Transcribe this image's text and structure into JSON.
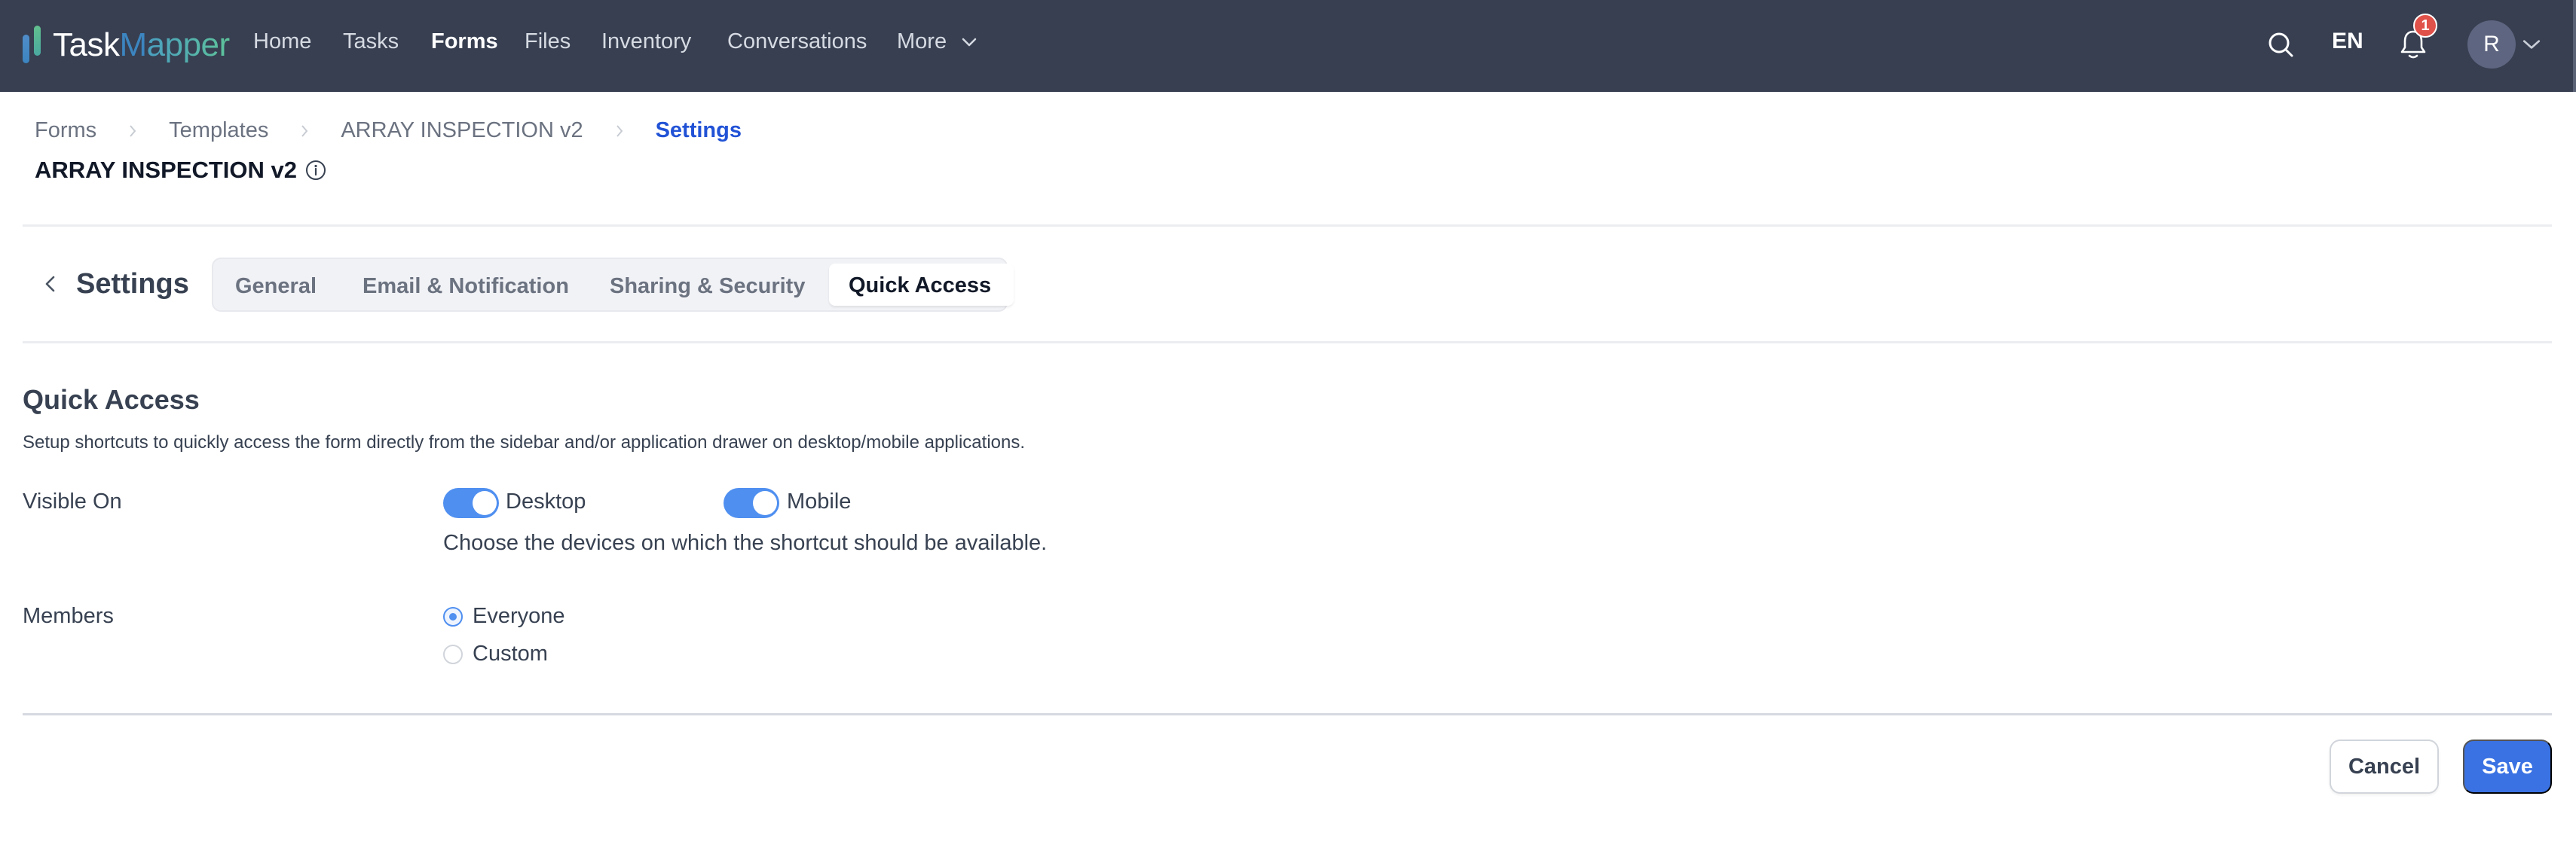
{
  "app": {
    "logo": {
      "part1": "Task",
      "part2": "M",
      "part3": "apper"
    }
  },
  "nav": {
    "items": [
      {
        "label": "Home",
        "active": false
      },
      {
        "label": "Tasks",
        "active": false
      },
      {
        "label": "Forms",
        "active": true
      },
      {
        "label": "Files",
        "active": false
      },
      {
        "label": "Inventory",
        "active": false
      },
      {
        "label": "Conversations",
        "active": false
      },
      {
        "label": "More",
        "active": false
      }
    ],
    "language": "EN",
    "notification_count": "1",
    "avatar_initial": "R",
    "icons": [
      "search-icon",
      "bell-icon",
      "chevron-down-icon"
    ]
  },
  "breadcrumb": [
    {
      "label": "Forms"
    },
    {
      "label": "Templates"
    },
    {
      "label": "ARRAY INSPECTION v2"
    },
    {
      "label": "Settings"
    }
  ],
  "page": {
    "title": "ARRAY INSPECTION v2"
  },
  "settings": {
    "title": "Settings",
    "tabs": [
      {
        "label": "General",
        "active": false
      },
      {
        "label": "Email & Notification",
        "active": false
      },
      {
        "label": "Sharing & Security",
        "active": false
      },
      {
        "label": "Quick Access",
        "active": true
      }
    ]
  },
  "quick_access": {
    "title": "Quick Access",
    "description": "Setup shortcuts to quickly access the form directly from the sidebar and/or application drawer on desktop/mobile applications.",
    "visible_on": {
      "label": "Visible On",
      "options": [
        {
          "label": "Desktop",
          "enabled": true
        },
        {
          "label": "Mobile",
          "enabled": true
        }
      ],
      "help": "Choose the devices on which the shortcut should be available."
    },
    "members": {
      "label": "Members",
      "options": [
        {
          "label": "Everyone",
          "selected": true
        },
        {
          "label": "Custom",
          "selected": false
        }
      ]
    }
  },
  "footer": {
    "cancel_label": "Cancel",
    "save_label": "Save"
  },
  "colors": {
    "topbar": "#373f51",
    "accent": "#3a72e3",
    "toggle_on": "#4f8ff0",
    "breadcrumb_current": "#2152d6",
    "badge": "#e0514a"
  }
}
